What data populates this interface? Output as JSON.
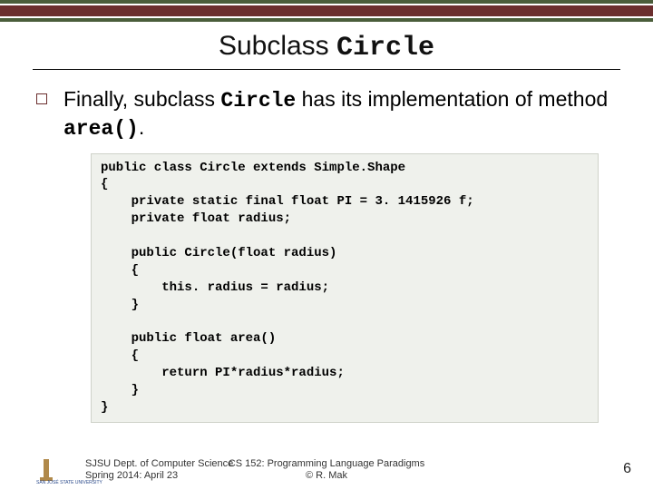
{
  "title_plain": "Subclass ",
  "title_mono": "Circle",
  "bullet": {
    "part1": "Finally, subclass ",
    "mono1": "Circle",
    "part2": " has its implementation of method ",
    "mono2": "area()",
    "part3": "."
  },
  "code": "public class Circle extends Simple.Shape\n{\n    private static final float PI = 3. 1415926 f;\n    private float radius;\n\n    public Circle(float radius)\n    {\n        this. radius = radius;\n    }\n\n    public float area()\n    {\n        return PI*radius*radius;\n    }\n}",
  "footer": {
    "left_line1": "SJSU Dept. of Computer Science",
    "left_line2": "Spring 2014: April 23",
    "center_line1": "CS 152: Programming Language Paradigms",
    "center_line2": "© R. Mak",
    "page": "6"
  },
  "logo_text": "SAN JOSÉ STATE\nUNIVERSITY"
}
